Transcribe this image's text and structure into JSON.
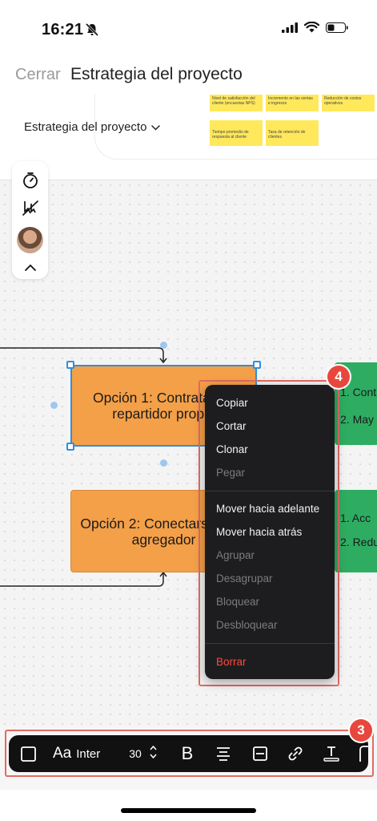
{
  "status": {
    "time": "16:21"
  },
  "nav": {
    "close_label": "Cerrar",
    "title": "Estrategia del proyecto"
  },
  "document": {
    "label": "Estrategia del proyecto",
    "notes": [
      "Nivel de satisfacción del cliente (encuestas NPS)",
      "Incremento en las ventas e ingresos",
      "Reducción de costos operativos",
      "Tiempo promedio de respuesta al cliente",
      "Tasa de retención de clientes"
    ]
  },
  "canvas": {
    "option1": "Opción 1: Contratar un repartidor propio",
    "option2": "Opción 2: Conectarse a un agregador",
    "green1_line1": "1. Cont",
    "green1_line2": "2. May",
    "green2_line1": "1. Acc",
    "green2_line2": "2. Redu"
  },
  "context_menu": {
    "copy": "Copiar",
    "cut": "Cortar",
    "clone": "Clonar",
    "paste": "Pegar",
    "bring_forward": "Mover hacia adelante",
    "send_backward": "Mover hacia atrás",
    "group": "Agrupar",
    "ungroup": "Desagrupar",
    "lock": "Bloquear",
    "unlock": "Desbloquear",
    "delete": "Borrar"
  },
  "badges": {
    "menu": "4",
    "toolbar": "3"
  },
  "toolbar": {
    "font_glyph": "Aa",
    "font_name": "Inter",
    "font_size": "30",
    "bold_glyph": "B"
  },
  "colors": {
    "accent_red": "#e8473d",
    "shape_orange": "#f4a048",
    "shape_green": "#2ead62",
    "selection_blue": "#2d8fe0"
  }
}
